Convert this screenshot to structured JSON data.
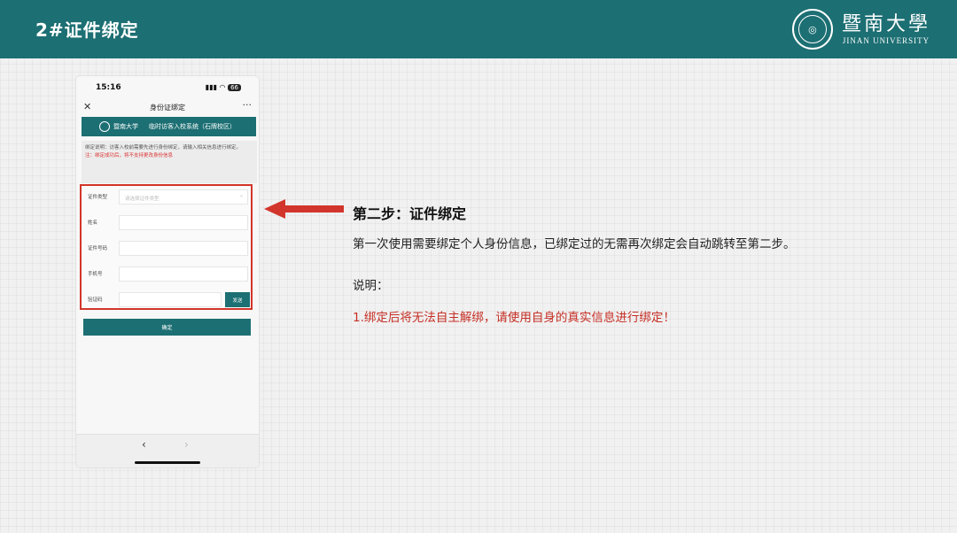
{
  "header": {
    "title": "2#证件绑定",
    "university_cn": "暨南大學",
    "university_en": "JINAN UNIVERSITY"
  },
  "phone": {
    "time": "15:16",
    "battery": "66",
    "nav_title": "身份证绑定",
    "banner_name": "暨南大学",
    "banner_text": "临时访客入校系统（石牌校区）",
    "notice": "绑定说明：访客入校前需要先进行身份绑定，请输入相关信息进行绑定。",
    "notice_warning": "注：绑定成功后，将不支持更改身份信息",
    "form": {
      "id_type_label": "证件类型",
      "id_type_placeholder": "请选择证件类型",
      "name_label": "姓名",
      "id_number_label": "证件号码",
      "phone_label": "手机号",
      "code_label": "验证码",
      "send_button": "发送"
    },
    "confirm_button": "确定"
  },
  "content": {
    "step_title": "第二步：证件绑定",
    "step_desc": "第一次使用需要绑定个人身份信息，已绑定过的无需再次绑定会自动跳转至第二步。",
    "note_label": "说明：",
    "note_text": "1.绑定后将无法自主解绑，请使用自身的真实信息进行绑定！"
  },
  "colors": {
    "brand": "#1c6f73",
    "highlight": "#d2352b",
    "warning_text": "#c62f25"
  }
}
